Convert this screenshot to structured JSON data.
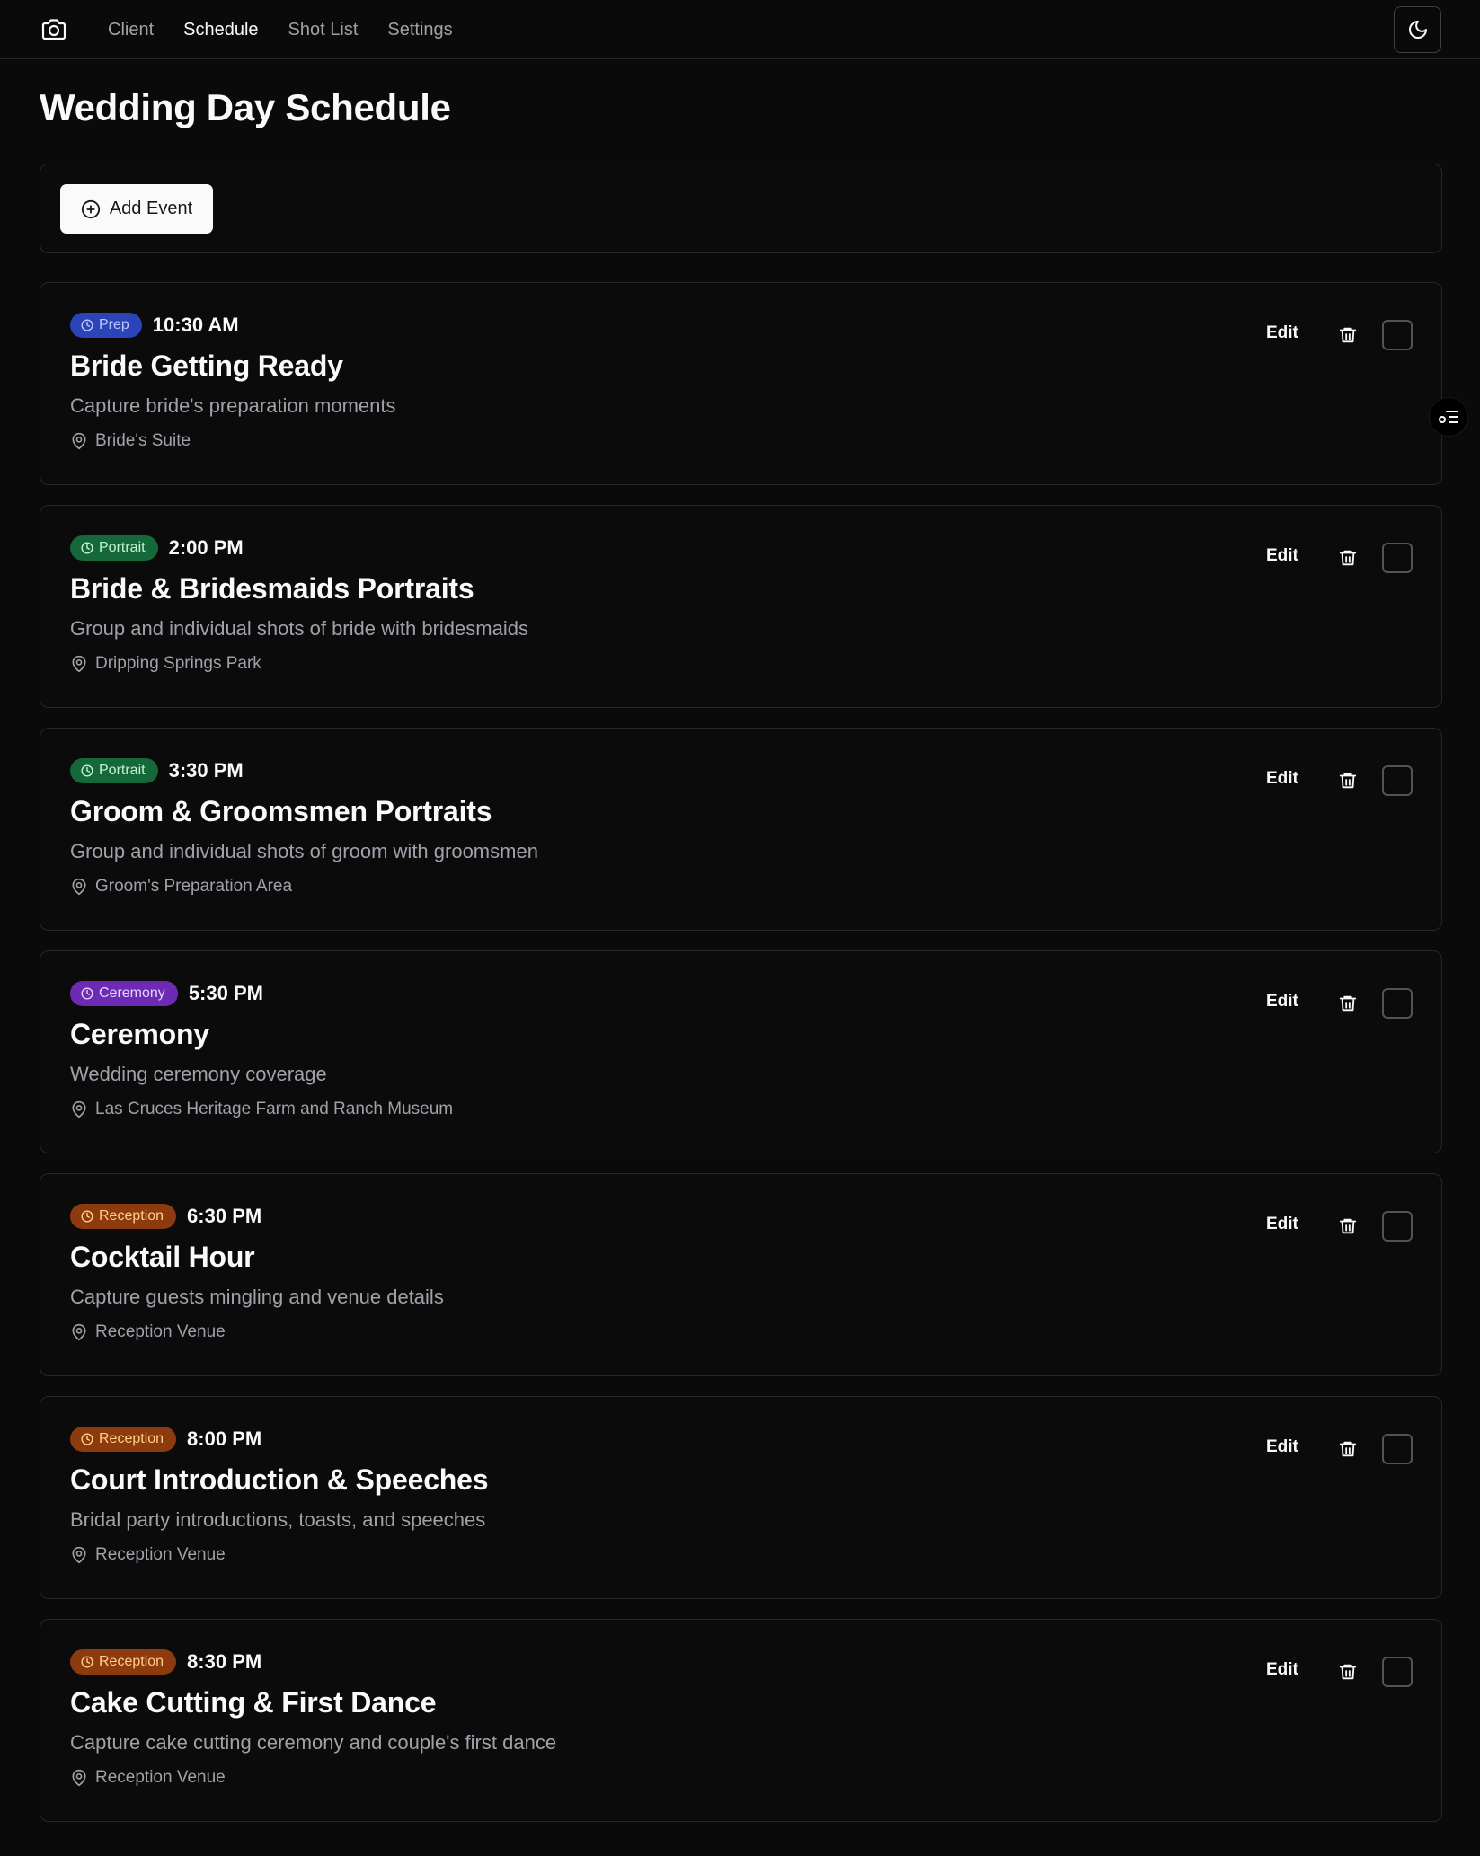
{
  "nav": {
    "links": [
      "Client",
      "Schedule",
      "Shot List",
      "Settings"
    ],
    "active": "Schedule"
  },
  "page": {
    "title": "Wedding Day Schedule"
  },
  "toolbar": {
    "add_label": "Add Event"
  },
  "colors": {
    "prep": "#2b44b8",
    "prep_text": "#bcc8ff",
    "portrait": "#15683a",
    "portrait_text": "#c4f2d2",
    "ceremony": "#6c2bb2",
    "ceremony_text": "#e6d4ff",
    "reception": "#8d3a0e",
    "reception_text": "#ffd08a"
  },
  "events": [
    {
      "badge": "Prep",
      "category": "prep",
      "time": "10:30 AM",
      "title": "Bride Getting Ready",
      "desc": "Capture bride's preparation moments",
      "location": "Bride's Suite",
      "edit": "Edit",
      "done": false
    },
    {
      "badge": "Portrait",
      "category": "portrait",
      "time": "2:00 PM",
      "title": "Bride & Bridesmaids Portraits",
      "desc": "Group and individual shots of bride with bridesmaids",
      "location": "Dripping Springs Park",
      "edit": "Edit",
      "done": false
    },
    {
      "badge": "Portrait",
      "category": "portrait",
      "time": "3:30 PM",
      "title": "Groom & Groomsmen Portraits",
      "desc": "Group and individual shots of groom with groomsmen",
      "location": "Groom's Preparation Area",
      "edit": "Edit",
      "done": false
    },
    {
      "badge": "Ceremony",
      "category": "ceremony",
      "time": "5:30 PM",
      "title": "Ceremony",
      "desc": "Wedding ceremony coverage",
      "location": "Las Cruces Heritage Farm and Ranch Museum",
      "edit": "Edit",
      "done": false
    },
    {
      "badge": "Reception",
      "category": "reception",
      "time": "6:30 PM",
      "title": "Cocktail Hour",
      "desc": "Capture guests mingling and venue details",
      "location": "Reception Venue",
      "edit": "Edit",
      "done": false
    },
    {
      "badge": "Reception",
      "category": "reception",
      "time": "8:00 PM",
      "title": "Court Introduction & Speeches",
      "desc": "Bridal party introductions, toasts, and speeches",
      "location": "Reception Venue",
      "edit": "Edit",
      "done": false
    },
    {
      "badge": "Reception",
      "category": "reception",
      "time": "8:30 PM",
      "title": "Cake Cutting & First Dance",
      "desc": "Capture cake cutting ceremony and couple's first dance",
      "location": "Reception Venue",
      "edit": "Edit",
      "done": false
    }
  ]
}
